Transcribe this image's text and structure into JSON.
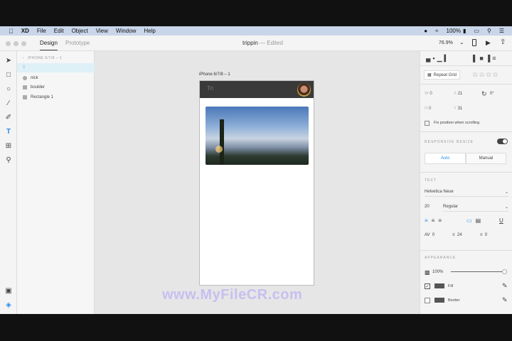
{
  "menubar": {
    "items": [
      "XD",
      "File",
      "Edit",
      "Object",
      "View",
      "Window",
      "Help"
    ],
    "battery": "100%"
  },
  "toolbar": {
    "tabs": [
      "Design",
      "Prototype"
    ],
    "doc_title": "trippin",
    "doc_status": "— Edited",
    "zoom": "76.9%"
  },
  "layers": {
    "breadcrumb": "IPHONE 6/7/8 – 1",
    "items": [
      {
        "name": "T",
        "type": "text"
      },
      {
        "name": "nick",
        "type": "ellipse"
      },
      {
        "name": "boulder",
        "type": "image"
      },
      {
        "name": "Rectangle 1",
        "type": "rect"
      }
    ]
  },
  "canvas": {
    "artboard_label": "iPhone 6/7/8 – 1",
    "header_text": "Tri",
    "watermark": "www.MyFileCR.com"
  },
  "inspector": {
    "repeat_grid": "Repeat Grid",
    "w_label": "W",
    "w": "0",
    "x_label": "X",
    "x": "21",
    "rotation": "0°",
    "h_label": "H",
    "h": "0",
    "y_label": "Y",
    "y": "31",
    "fix_position": "Fix position when scrolling",
    "responsive_resize": "RESPONSIVE RESIZE",
    "auto": "Auto",
    "manual": "Manual",
    "text_section": "TEXT",
    "font": "Helvetica Neue",
    "font_size": "20",
    "font_weight": "Regular",
    "char_spacing": "0",
    "line_spacing": "24",
    "para_spacing": "0",
    "appearance": "APPEARANCE",
    "opacity": "100%",
    "opacity_value": 1.0,
    "fill": "Fill",
    "fill_checked": true,
    "border": "Border",
    "border_checked": false
  },
  "colors": {
    "accent": "#2d8ceb",
    "header": "#3a3a3a",
    "menubar": "#c9d6ea"
  }
}
